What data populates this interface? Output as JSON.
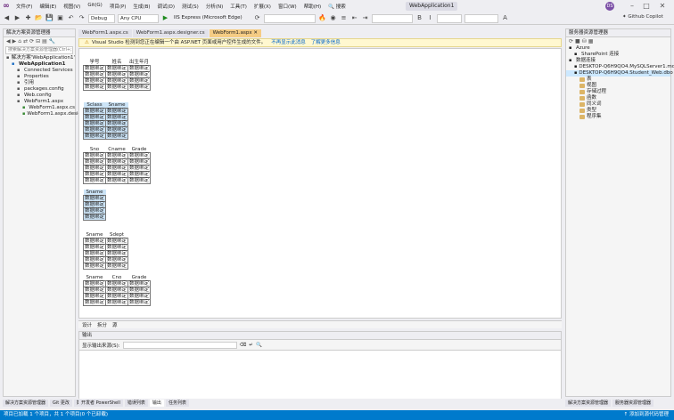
{
  "menu": [
    "文件(F)",
    "编辑(E)",
    "视图(V)",
    "Git(G)",
    "项目(P)",
    "生成(B)",
    "调试(D)",
    "测试(S)",
    "分析(N)",
    "工具(T)",
    "扩展(X)",
    "窗口(W)",
    "帮助(H)"
  ],
  "search_label": "搜索",
  "solution_title": "WebApplication1",
  "avatar_initials": "DS",
  "toolbar": {
    "config": "Debug",
    "platform": "Any CPU",
    "run_target": "IIS Express (Microsoft Edge)",
    "browser_combo": "",
    "ai_label": "Github Copilot"
  },
  "left_panel": {
    "title": "解决方案资源管理器",
    "search_placeholder": "搜索解决方案资源管理器(Ctrl+;)",
    "items": [
      {
        "label": "解决方案'WebApplication1'",
        "indent": 0,
        "icon": "solution-icon"
      },
      {
        "label": "WebApplication1",
        "indent": 1,
        "icon": "project-icon",
        "bold": true
      },
      {
        "label": "Connected Services",
        "indent": 2,
        "icon": "connected-icon"
      },
      {
        "label": "Properties",
        "indent": 2,
        "icon": "properties-icon"
      },
      {
        "label": "引用",
        "indent": 2,
        "icon": "references-icon"
      },
      {
        "label": "packages.config",
        "indent": 2,
        "icon": "file-icon"
      },
      {
        "label": "Web.config",
        "indent": 2,
        "icon": "config-icon"
      },
      {
        "label": "WebForm1.aspx",
        "indent": 2,
        "icon": "aspx-icon"
      },
      {
        "label": "WebForm1.aspx.cs",
        "indent": 3,
        "icon": "cs-icon"
      },
      {
        "label": "WebForm1.aspx.designer.cs",
        "indent": 3,
        "icon": "cs-icon"
      }
    ]
  },
  "doc_tabs": [
    {
      "label": "WebForm1.aspx.cs",
      "active": false
    },
    {
      "label": "WebForm1.aspx.designer.cs",
      "active": false
    },
    {
      "label": "WebForm1.aspx",
      "active": true
    }
  ],
  "infobar": {
    "text": "Visual Studio 检测到您正在编辑一个由 ASP.NET 页面或用户控件生成的文件。",
    "link1": "不再显示此消息",
    "link2": "了解更多信息"
  },
  "design_tables": [
    {
      "selected": false,
      "header": [
        "学号",
        "姓名",
        "出生年月"
      ],
      "rows": 4,
      "cell": "数据绑定"
    },
    {
      "selected": true,
      "header": [
        "Sclass",
        "Sname"
      ],
      "rows": 5,
      "cell": "数据绑定"
    },
    {
      "selected": false,
      "header": [
        "Sno",
        "Cname",
        "Grade"
      ],
      "rows": 5,
      "cell": "数据绑定"
    },
    {
      "selected": true,
      "header": [
        "Sname"
      ],
      "rows": 4,
      "cell": "数据绑定"
    },
    {
      "selected": false,
      "header": [
        "Sname",
        "Sdept"
      ],
      "rows": 5,
      "cell": "数据绑定"
    },
    {
      "selected": false,
      "header": [
        "Sname",
        "Cno",
        "Grade"
      ],
      "rows": 4,
      "cell": "数据绑定"
    }
  ],
  "view_tabs": [
    "设计",
    "拆分",
    "源"
  ],
  "output": {
    "title": "输出",
    "show_from": "显示输出来源(S):"
  },
  "right_panel": {
    "title": "服务器资源管理器",
    "items": [
      {
        "label": "Azure",
        "indent": 0
      },
      {
        "label": "SharePoint 连接",
        "indent": 1
      },
      {
        "label": "数据连接",
        "indent": 0
      },
      {
        "label": "DESKTOP-Q6H9QO4.MySQLServer1.mdf",
        "indent": 1
      },
      {
        "label": "DESKTOP-Q6H9QO4.Student_Web.dbo",
        "indent": 1,
        "selected": true
      },
      {
        "label": "表",
        "indent": 2
      },
      {
        "label": "视图",
        "indent": 2
      },
      {
        "label": "存储过程",
        "indent": 2
      },
      {
        "label": "函数",
        "indent": 2
      },
      {
        "label": "同义词",
        "indent": 2
      },
      {
        "label": "类型",
        "indent": 2
      },
      {
        "label": "程序集",
        "indent": 2
      }
    ]
  },
  "bottom_left_tabs": [
    "解决方案资源管理器",
    "Git 更改",
    "数据源"
  ],
  "bottom_mid_tabs": [
    "开发者 PowerShell",
    "错误列表",
    "输出",
    "任务列表"
  ],
  "bottom_right_tabs": [
    "解决方案资源管理器",
    "服务器资源管理器"
  ],
  "status": {
    "left": "项目已加载 1 个项目，共 1 个项目(0 个已卸载)",
    "right": "添加到源代码管理"
  }
}
